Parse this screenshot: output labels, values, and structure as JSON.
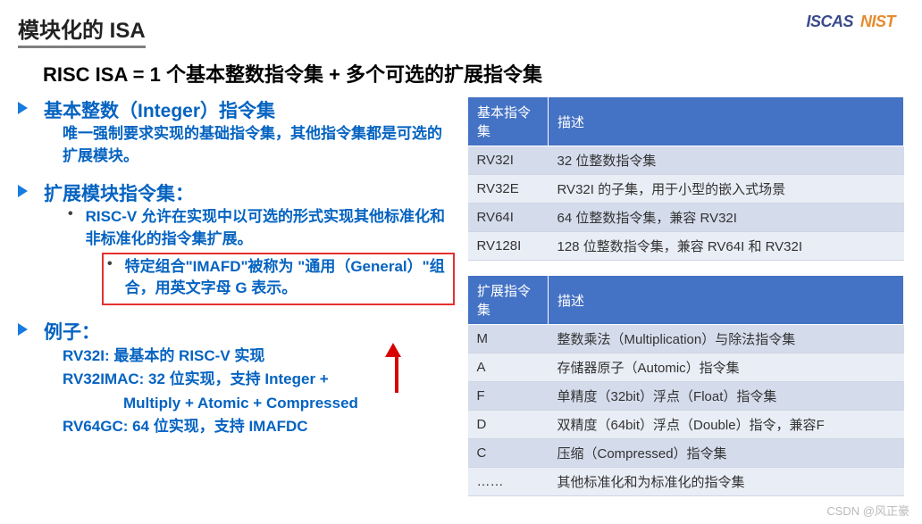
{
  "header": {
    "title": "模块化的 ISA",
    "logo1": "ISCAS",
    "logo2": "NIST"
  },
  "subtitle": "RISC ISA = 1 个基本整数指令集 + 多个可选的扩展指令集",
  "sections": {
    "integer": {
      "title": "基本整数（Integer）指令集",
      "body": "唯一强制要求实现的基础指令集，其他指令集都是可选的扩展模块。"
    },
    "ext": {
      "title": "扩展模块指令集：",
      "b1": "RISC-V 允许在实现中以可选的形式实现其他标准化和非标准化的指令集扩展。",
      "b2": "特定组合\"IMAFD\"被称为 \"通用（General）\"组合，用英文字母 G 表示。"
    },
    "example": {
      "title": "例子：",
      "e1": "RV32I: 最基本的 RISC-V 实现",
      "e2a": "RV32IMAC:  32 位实现，支持 Integer +",
      "e2b": "Multiply + Atomic + Compressed",
      "e3": "RV64GC: 64 位实现，支持 IMAFDC"
    }
  },
  "table1": {
    "h1": "基本指令集",
    "h2": "描述",
    "rows": [
      {
        "c1": "RV32I",
        "c2": "32 位整数指令集"
      },
      {
        "c1": "RV32E",
        "c2": "RV32I 的子集，用于小型的嵌入式场景"
      },
      {
        "c1": "RV64I",
        "c2": "64 位整数指令集，兼容 RV32I"
      },
      {
        "c1": "RV128I",
        "c2": "128 位整数指令集，兼容 RV64I 和 RV32I"
      }
    ]
  },
  "table2": {
    "h1": "扩展指令集",
    "h2": "描述",
    "rows": [
      {
        "c1": "M",
        "c2": "整数乘法（Multiplication）与除法指令集"
      },
      {
        "c1": "A",
        "c2": "存储器原子（Automic）指令集"
      },
      {
        "c1": "F",
        "c2": "单精度（32bit）浮点（Float）指令集"
      },
      {
        "c1": "D",
        "c2": "双精度（64bit）浮点（Double）指令，兼容F"
      },
      {
        "c1": "C",
        "c2": "压缩（Compressed）指令集"
      },
      {
        "c1": "……",
        "c2": "其他标准化和为标准化的指令集"
      }
    ]
  },
  "watermark": "CSDN @风正豪"
}
